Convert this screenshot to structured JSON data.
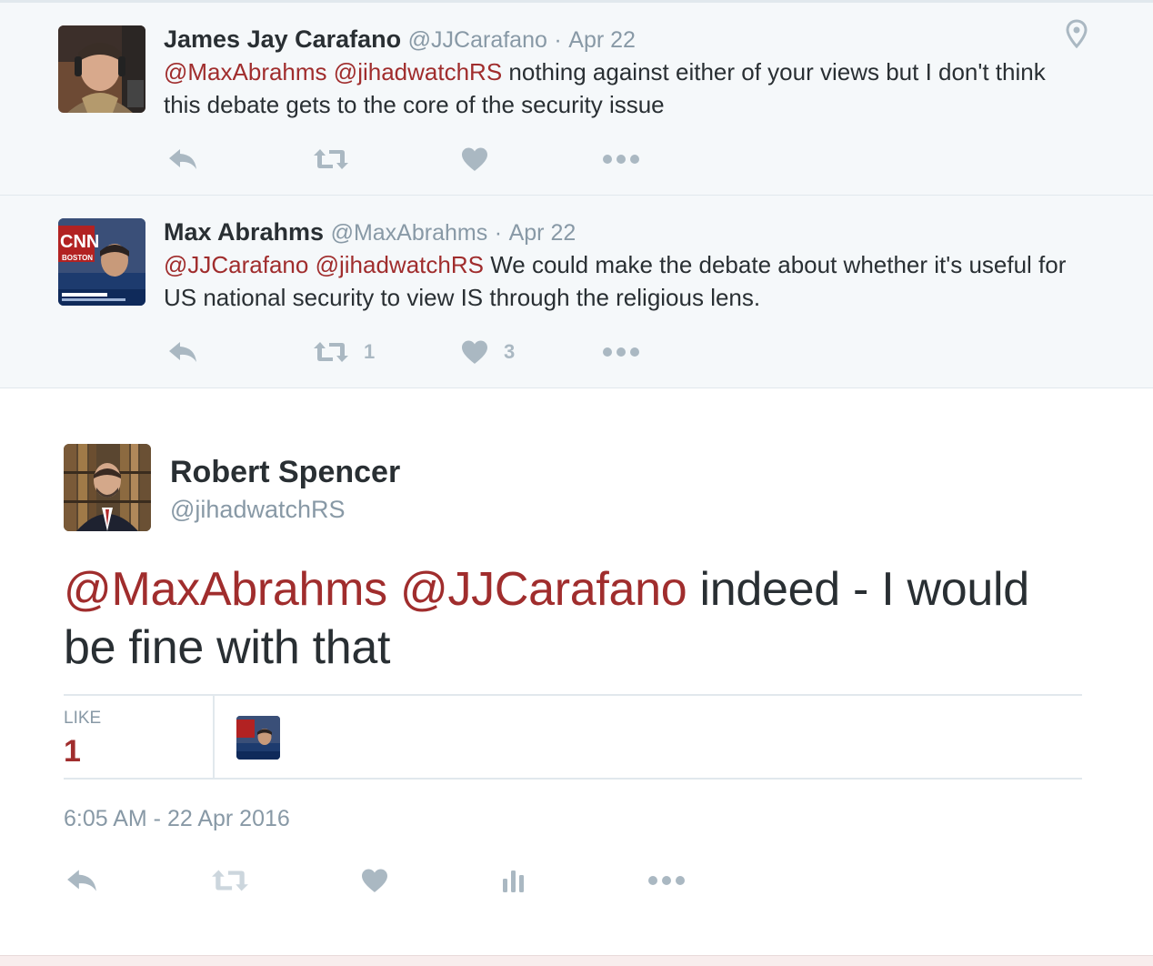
{
  "colors": {
    "mention": "#a02d2d",
    "muted": "#8899a6",
    "icon": "#aab8c2",
    "context_bg": "#f5f8fa"
  },
  "replies": [
    {
      "name": "James Jay Carafano",
      "handle": "@JJCarafano",
      "separator": "·",
      "date": "Apr 22",
      "mention1": "@MaxAbrahms",
      "mention2": "@jihadwatchRS",
      "text": "nothing against either of your views but I don't think this debate gets to the core of the security issue",
      "retweet_count": "",
      "like_count": "",
      "icons": [
        "reply-icon",
        "retweet-icon",
        "heart-icon",
        "more-icon",
        "location-pin-icon"
      ]
    },
    {
      "name": "Max Abrahms",
      "handle": "@MaxAbrahms",
      "separator": "·",
      "date": "Apr 22",
      "mention1": "@JJCarafano",
      "mention2": "@jihadwatchRS",
      "text": "We could make the debate about whether it's useful for US national security to view IS through the religious lens.",
      "retweet_count": "1",
      "like_count": "3",
      "avatar_overlay": "CNN",
      "avatar_sub": "BOSTON"
    }
  ],
  "main_tweet": {
    "name": "Robert Spencer",
    "handle": "@jihadwatchRS",
    "mention1": "@MaxAbrahms",
    "mention2": "@JJCarafano",
    "text": "indeed - I would be fine with that",
    "like_label": "LIKE",
    "like_count": "1",
    "timestamp": "6:05 AM - 22 Apr 2016",
    "icons": [
      "reply-icon",
      "retweet-icon",
      "heart-icon",
      "analytics-icon",
      "more-icon"
    ]
  }
}
